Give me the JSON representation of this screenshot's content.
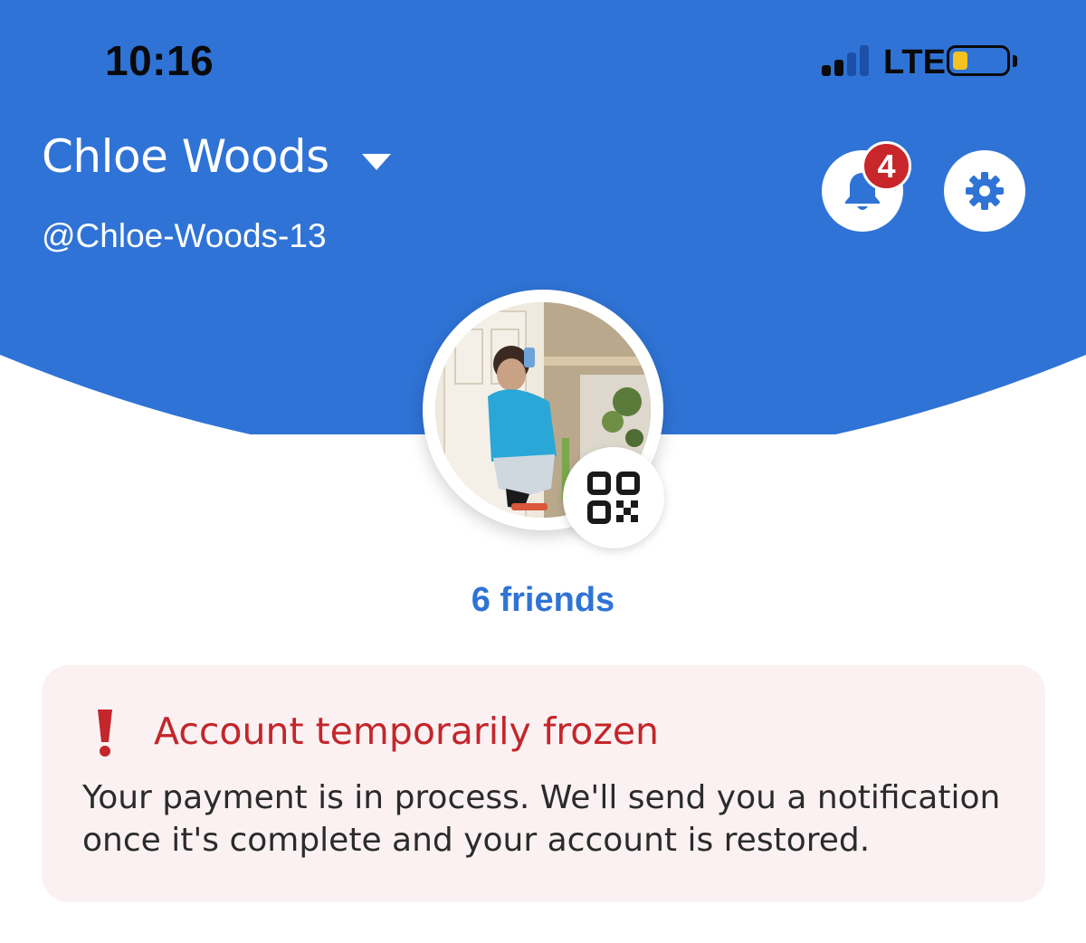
{
  "status_bar": {
    "time": "10:16",
    "network": "LTE",
    "signal_icon": "cellular-signal-icon",
    "battery_icon": "battery-low-icon",
    "battery_level": 0.2
  },
  "header": {
    "name": "Chloe Woods",
    "username": "@Chloe-Woods-13",
    "notification_count": "4",
    "accent_color": "#2f73d6"
  },
  "profile": {
    "friends_label": "6 friends"
  },
  "alert": {
    "title": "Account temporarily frozen",
    "message": "Your payment is in process. We'll send you a notification once it's complete and your account is restored.",
    "color": "#c3262b"
  },
  "icons": [
    "chevron-down-icon",
    "bell-icon",
    "gear-icon",
    "qr-code-icon",
    "exclamation-icon"
  ]
}
